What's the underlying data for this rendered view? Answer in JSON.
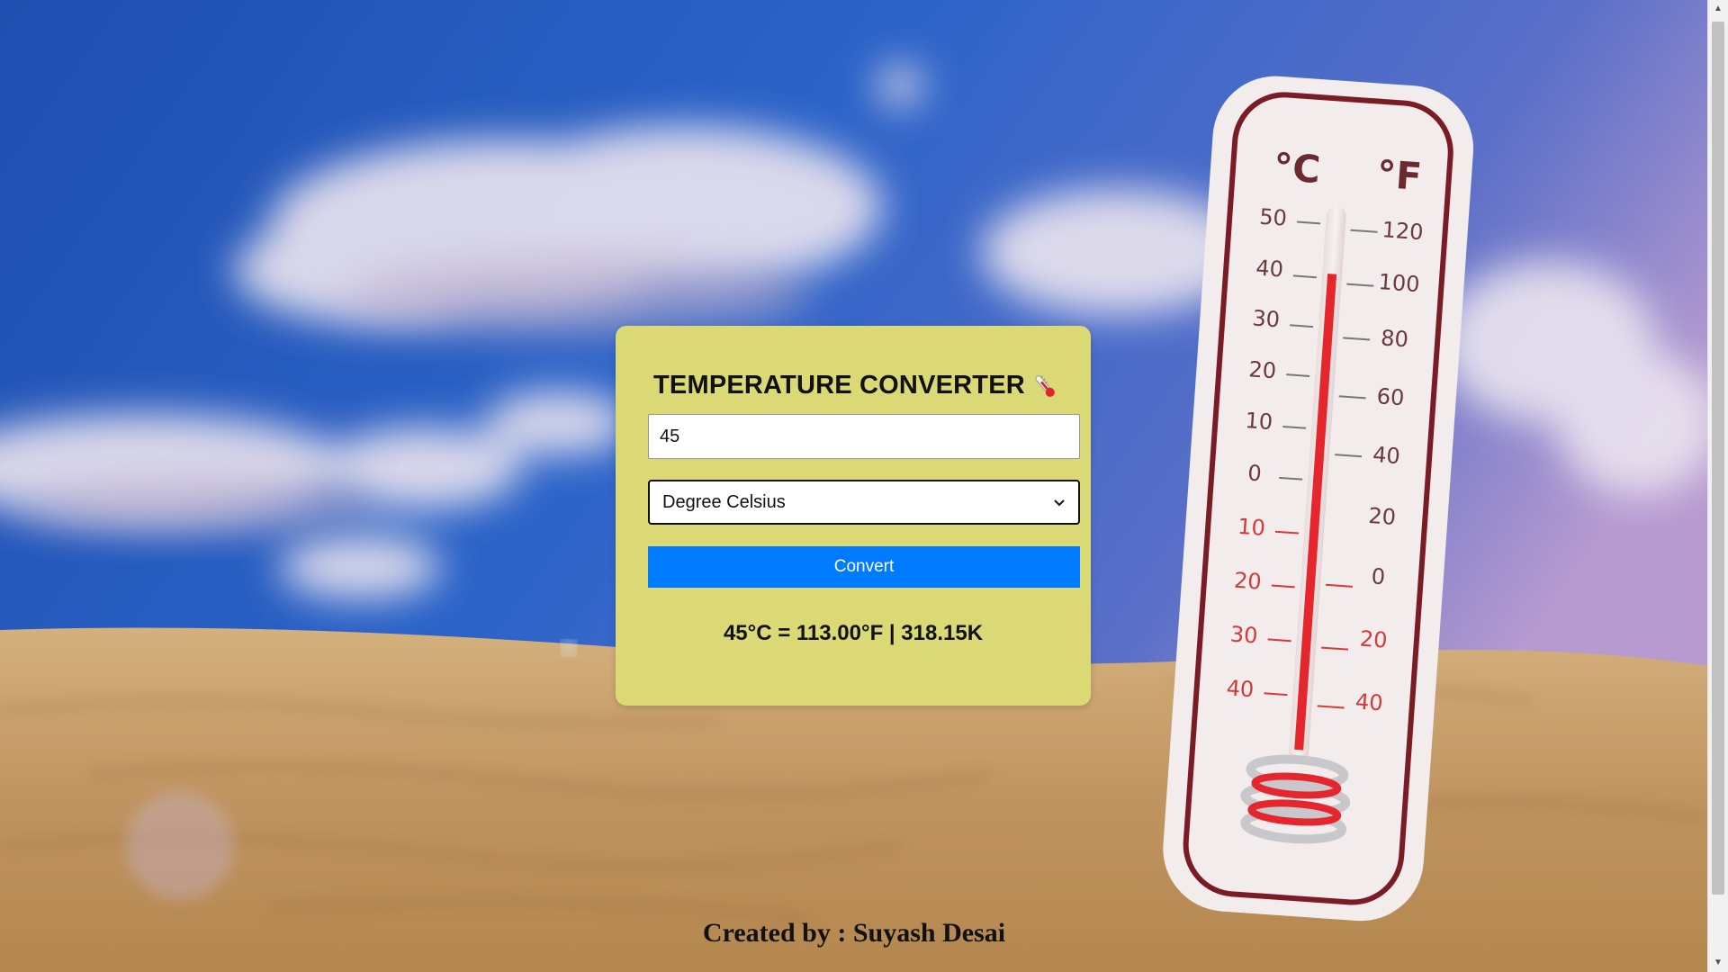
{
  "converter": {
    "title": "TEMPERATURE CONVERTER",
    "title_icon": "thermometer-icon",
    "input_value": "45",
    "unit_selected": "Degree Celsius",
    "unit_icon": "chevron-down-icon",
    "convert_label": "Convert",
    "result": "45°C = 113.00°F | 318.15K"
  },
  "footer": {
    "credit": "Created by : Suyash Desai"
  },
  "colors": {
    "card_background": "#dbd876",
    "button_background": "#007bff",
    "button_text": "#ffffff"
  },
  "background": {
    "thermometer_celsius_label": "°C",
    "thermometer_fahrenheit_label": "°F",
    "celsius_ticks": [
      "50",
      "40",
      "30",
      "20",
      "10",
      "0",
      "10",
      "20",
      "30",
      "40"
    ],
    "fahrenheit_ticks": [
      "120",
      "100",
      "80",
      "60",
      "40",
      "20",
      "0",
      "20",
      "40"
    ]
  }
}
